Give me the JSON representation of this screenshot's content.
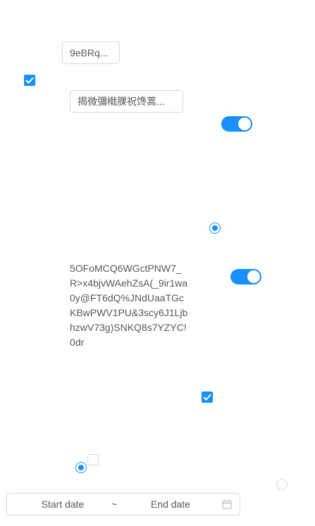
{
  "buttons": {
    "top_button_label": "9eBRq...",
    "chinese_button_label": "揭微彌橶腂祝馋蒿..."
  },
  "long_text": "5OFoMCQ6WGctPNW7_R>x4bjvWAehZsA(_9ir1wa0y@FT6dQ%JNdUaaTGcKBwPWV1PU&3scy6J1LjbhzwV73g)SNKQ8s7YZYC!0dr",
  "date_range": {
    "start_placeholder": "Start date",
    "separator": "~",
    "end_placeholder": "End date",
    "icon": "calendar-icon"
  },
  "checkboxes": [
    {
      "checked": true
    },
    {
      "checked": true
    },
    {
      "checked": false
    }
  ],
  "toggles": [
    {
      "on": true
    },
    {
      "on": true
    }
  ],
  "radios": [
    {
      "checked": true
    },
    {
      "checked": true
    },
    {
      "checked": false
    }
  ],
  "colors": {
    "accent": "#1890ff",
    "border": "#d9d9d9"
  }
}
